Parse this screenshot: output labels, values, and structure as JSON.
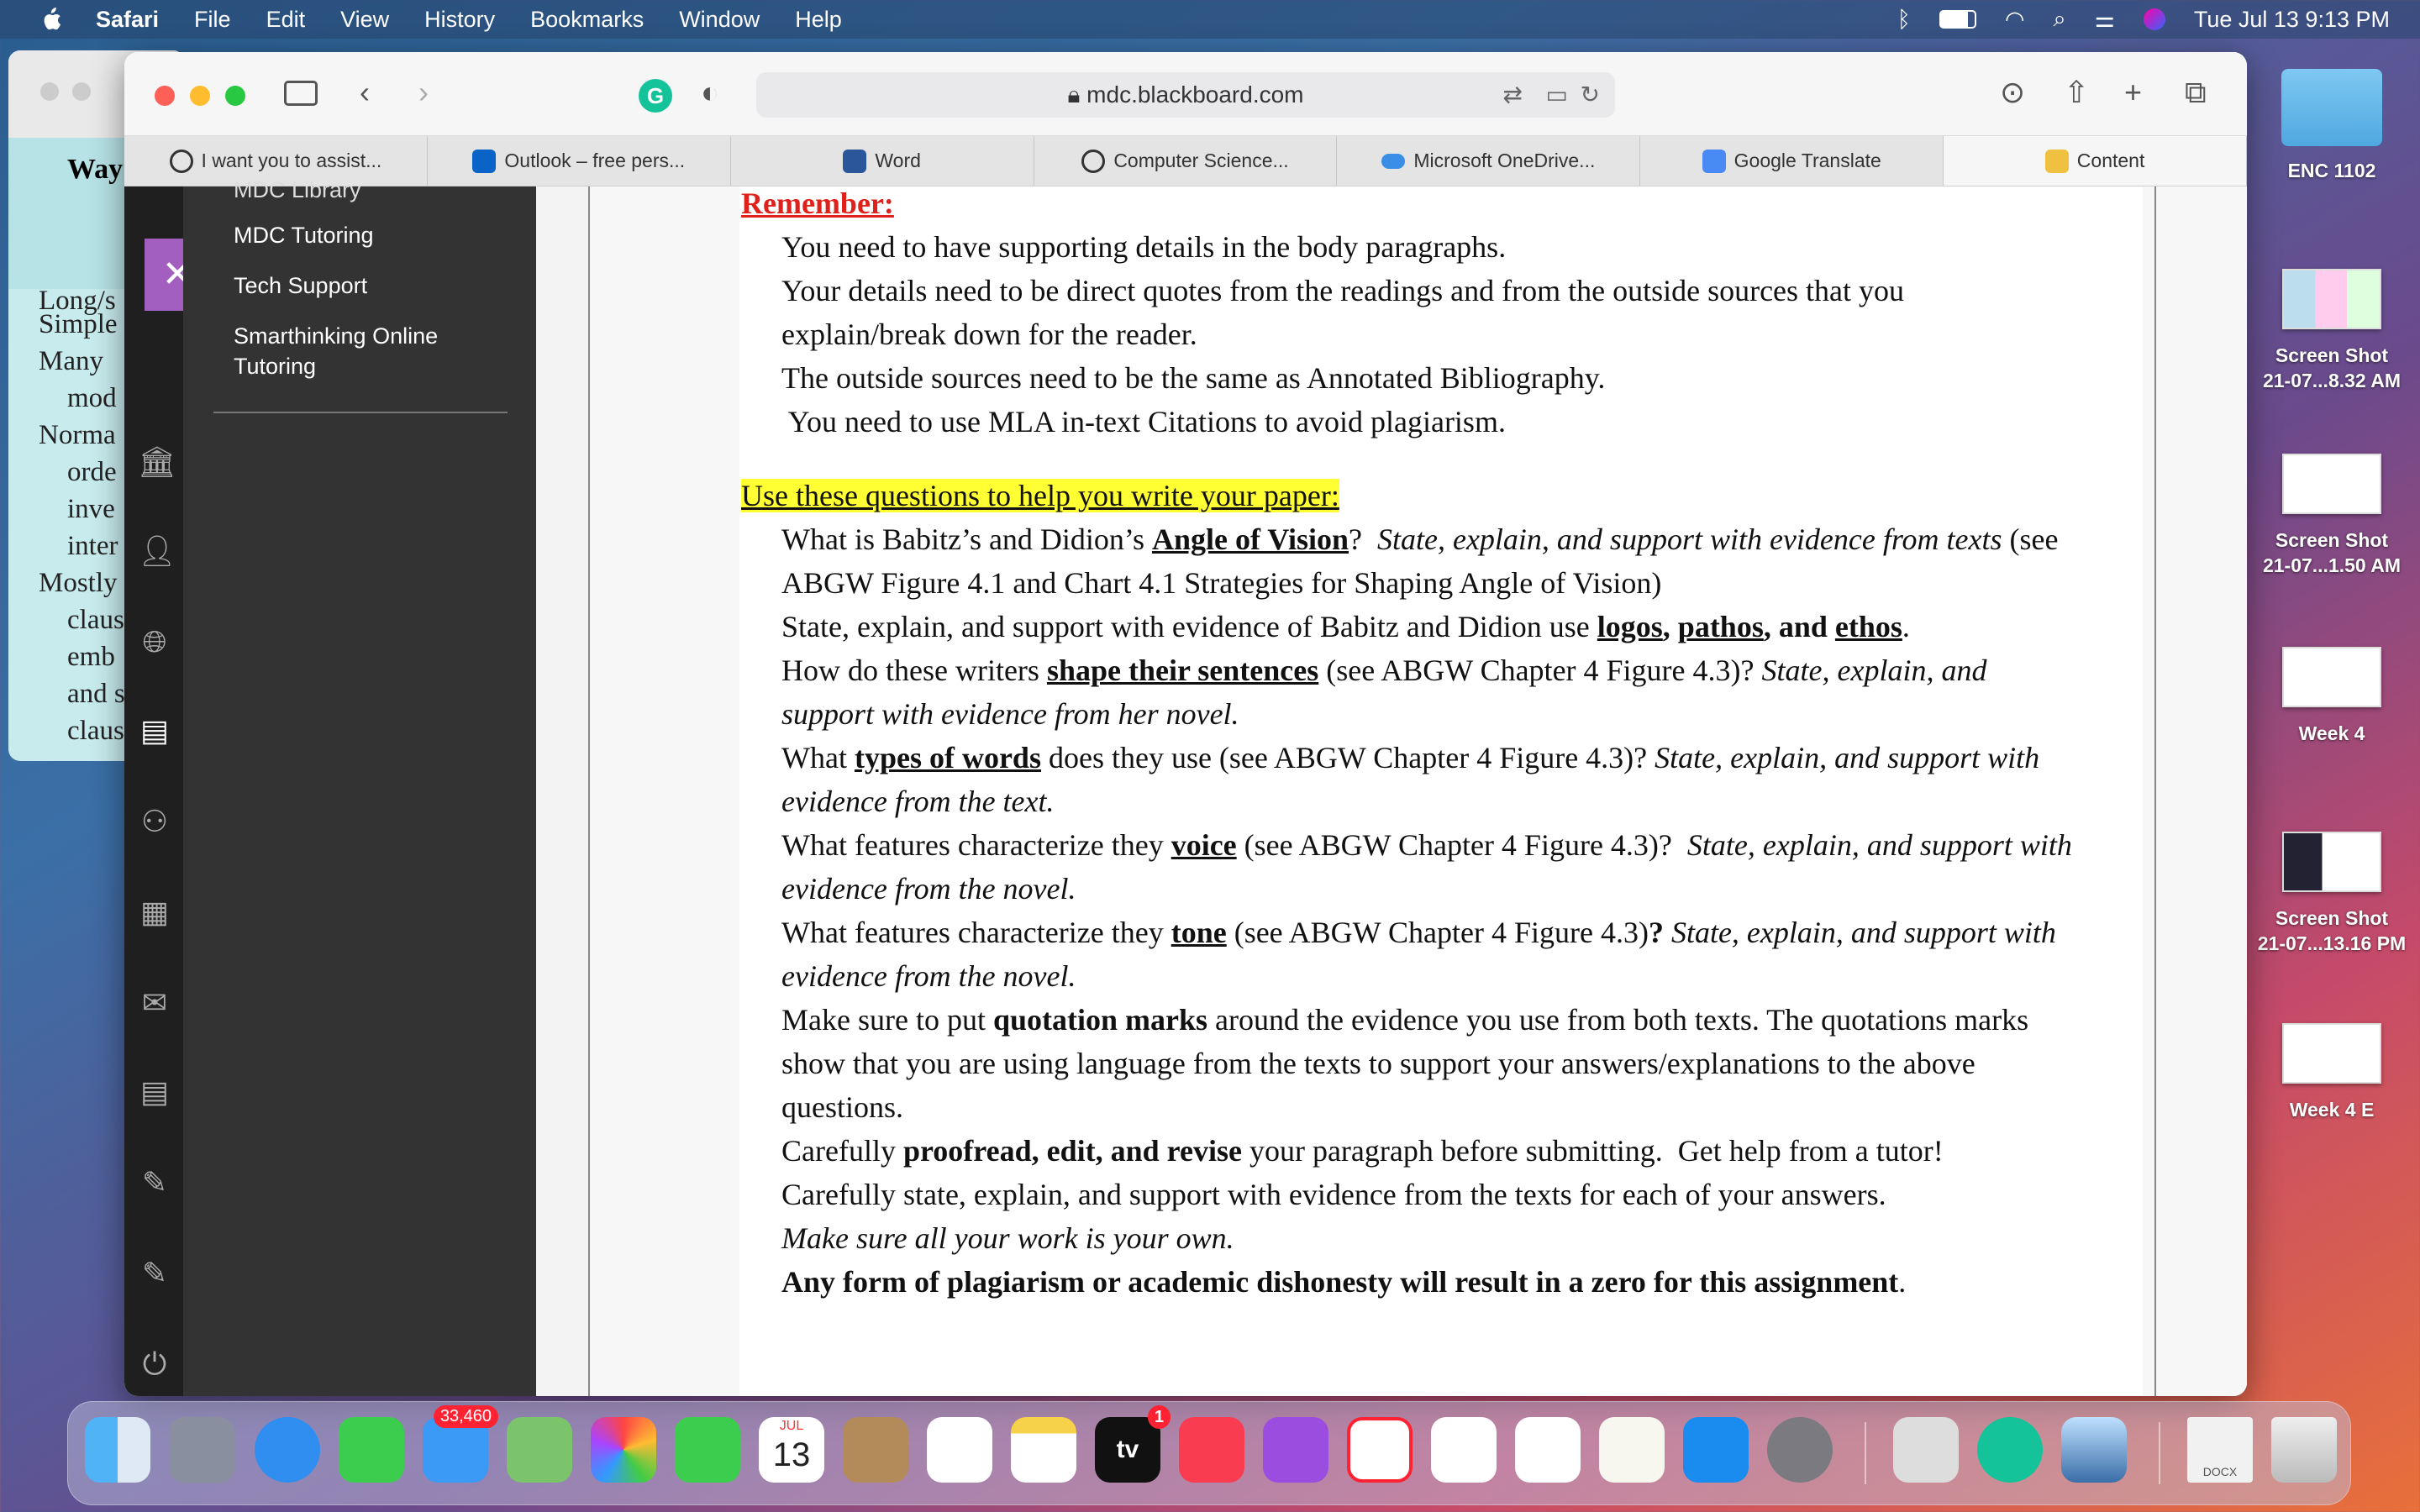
{
  "menubar": {
    "app": "Safari",
    "items": [
      "File",
      "Edit",
      "View",
      "History",
      "Bookmarks",
      "Window",
      "Help"
    ],
    "datetime": "Tue Jul 13  9:13 PM"
  },
  "browser": {
    "url": "mdc.blackboard.com",
    "tabs": [
      "I want you to assist...",
      "Outlook – free pers...",
      "Word",
      "Computer Science...",
      "Microsoft OneDrive...",
      "Google Translate",
      "Content"
    ]
  },
  "bg_window": {
    "heading": "Way s",
    "lines": [
      "Long/s",
      "Simple",
      "Many",
      "mod",
      "Norma",
      "orde",
      "inve",
      "inter",
      "Mostly",
      "claus",
      "emb",
      "and s",
      "claus"
    ]
  },
  "nav": {
    "items": [
      "MDC Library",
      "MDC Tutoring",
      "Tech Support",
      "Smarthinking Online",
      "Tutoring"
    ]
  },
  "doc": {
    "remember": "Remember:",
    "r1": "You need to have supporting details in the body paragraphs.",
    "r2": "Your details need to be direct quotes from the readings and from the outside sources that you",
    "r3": "explain/break down for the reader.",
    "r4": "The outside sources need to be the same as Annotated Bibliography.",
    "r5": " You need to use MLA in-text Citations to avoid plagiarism.",
    "q_head": "Use these questions to help you write your paper:",
    "q1a": "What is Babitz’s and Didion’s ",
    "q1b": "Angle of Vision",
    "q1c": "?  ",
    "q1d": "State, explain, and support with evidence from texts",
    "q1e": " (see",
    "q2": "ABGW Figure 4.1 and Chart 4.1 Strategies for Shaping Angle of Vision)",
    "q3a": "State, explain, and support with evidence of Babitz and Didion use ",
    "q3b": "logos",
    "q3c": ", ",
    "q3d": "pathos",
    "q3e": ", and ",
    "q3f": "ethos",
    "q3g": ".",
    "q4a": "How do these writers ",
    "q4b": "shape their sentences",
    "q4c": " (see ABGW Chapter 4 Figure 4.3)? ",
    "q4d": "State, explain, and",
    "q5": "support with evidence from her novel.",
    "q6a": "What ",
    "q6b": "types of words",
    "q6c": " does they use (see ABGW Chapter 4 Figure 4.3)? ",
    "q6d": "State, explain, and support with",
    "q7": "evidence from the text.",
    "q8a": "What features characterize they ",
    "q8b": "voice",
    "q8c": " (see ABGW Chapter 4 Figure 4.3)?  ",
    "q8d": "State, explain, and support with",
    "q9": "evidence from the novel.",
    "q10a": "What features characterize they ",
    "q10b": "tone",
    "q10c": " (see ABGW Chapter 4 Figure 4.3)",
    "q10d": "? ",
    "q10e": "State, explain, and support with",
    "q11": "evidence from the novel.",
    "q12a": "Make sure to put ",
    "q12b": "quotation marks",
    "q12c": " around the evidence you use from both texts. The quotations marks",
    "q13": "show that you are using language from the texts to support your answers/explanations to the above",
    "q14": "questions.",
    "q15a": "Carefully ",
    "q15b": "proofread, edit, and revise",
    "q15c": " your paragraph before submitting.  Get help from a tutor!",
    "q16": "Carefully state, explain, and support with evidence from the texts for each of your answers.",
    "q17": "Make sure all your work is your own.",
    "q18a": "Any form of plagiarism or academic dishonesty will result in a zero for this assignment",
    "q18b": "."
  },
  "desktop": {
    "items": [
      "ENC 1102",
      "Screen Shot",
      "21-07...8.32 AM",
      "Screen Shot",
      "21-07...1.50 AM",
      "Week 4",
      "Screen Shot",
      "21-07...13.16 PM",
      "Week 4 E"
    ]
  },
  "dock": {
    "mail_badge": "33,460",
    "calendar_month": "JUL",
    "calendar_day": "13",
    "tv_badge": "1",
    "tv_label": "tv",
    "docx_label": "DOCX"
  }
}
